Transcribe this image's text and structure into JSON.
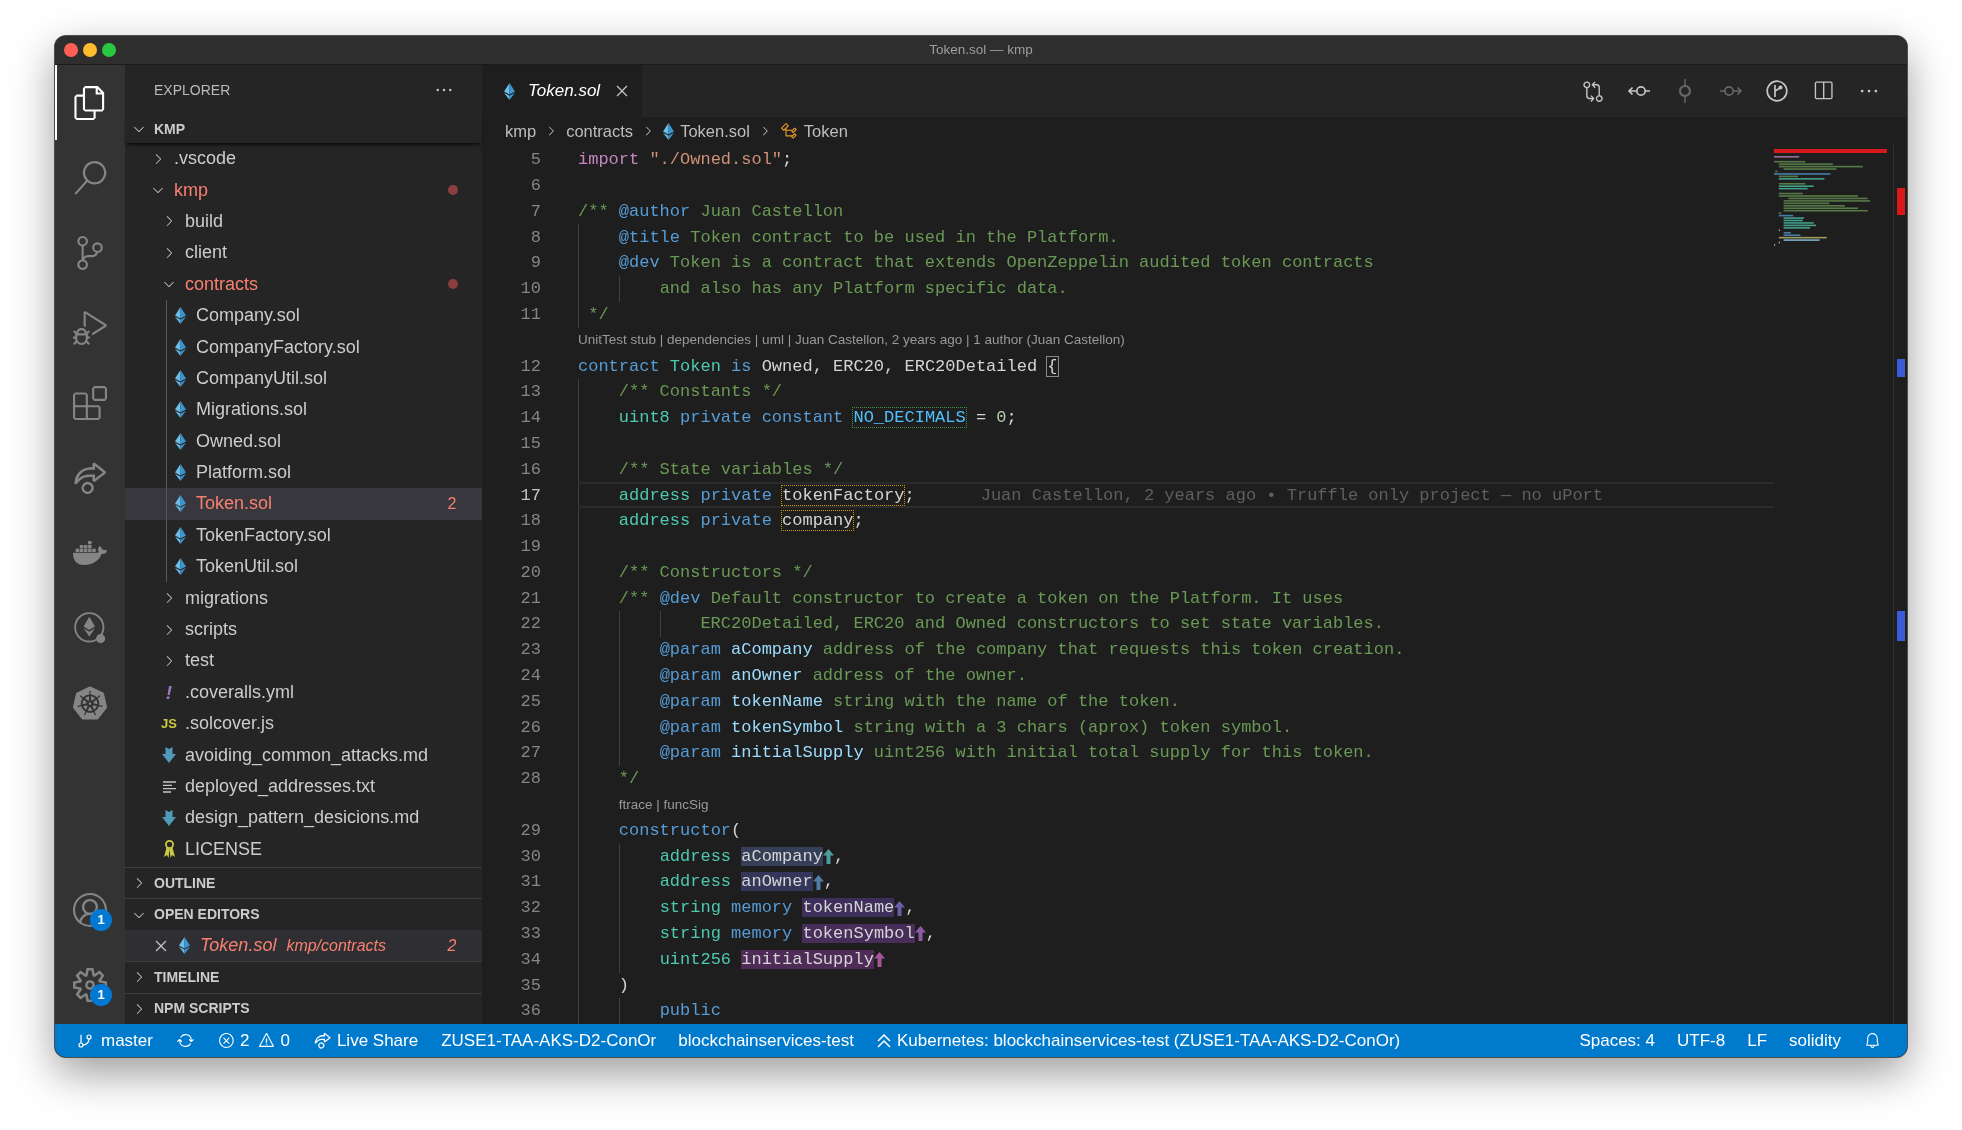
{
  "window": {
    "title": "Token.sol — kmp"
  },
  "activity_bar": {
    "items": [
      {
        "kind": "explorer",
        "selected": true
      },
      {
        "kind": "search",
        "selected": false
      },
      {
        "kind": "source_control",
        "selected": false
      },
      {
        "kind": "run_debug",
        "selected": false
      },
      {
        "kind": "extensions",
        "selected": false
      },
      {
        "kind": "live_share",
        "selected": false
      },
      {
        "kind": "docker",
        "selected": false
      },
      {
        "kind": "ethereum",
        "selected": false
      },
      {
        "kind": "kubernetes",
        "selected": false
      }
    ],
    "bottom": [
      {
        "kind": "accounts",
        "badge": "1"
      },
      {
        "kind": "manage",
        "badge": "1"
      }
    ]
  },
  "explorer": {
    "title": "EXPLORER",
    "root": {
      "label": "KMP",
      "expanded": true,
      "children": [
        {
          "name": ".vscode",
          "kind": "folder",
          "expanded": false,
          "has_errors": false,
          "selected": false
        },
        {
          "name": "kmp",
          "kind": "folder",
          "expanded": true,
          "has_errors": true,
          "selected": false,
          "children": [
            {
              "name": "build",
              "kind": "folder",
              "expanded": false,
              "has_errors": false,
              "selected": false
            },
            {
              "name": "client",
              "kind": "folder",
              "expanded": false,
              "has_errors": false,
              "selected": false
            },
            {
              "name": "contracts",
              "kind": "folder",
              "expanded": true,
              "has_errors": true,
              "selected": false,
              "children": [
                {
                  "name": "Company.sol",
                  "kind": "solidity",
                  "has_errors": false,
                  "selected": false
                },
                {
                  "name": "CompanyFactory.sol",
                  "kind": "solidity",
                  "has_errors": false,
                  "selected": false
                },
                {
                  "name": "CompanyUtil.sol",
                  "kind": "solidity",
                  "has_errors": false,
                  "selected": false
                },
                {
                  "name": "Migrations.sol",
                  "kind": "solidity",
                  "has_errors": false,
                  "selected": false
                },
                {
                  "name": "Owned.sol",
                  "kind": "solidity",
                  "has_errors": false,
                  "selected": false
                },
                {
                  "name": "Platform.sol",
                  "kind": "solidity",
                  "has_errors": false,
                  "selected": false
                },
                {
                  "name": "Token.sol",
                  "kind": "solidity",
                  "has_errors": true,
                  "selected": true,
                  "badge": "2"
                },
                {
                  "name": "TokenFactory.sol",
                  "kind": "solidity",
                  "has_errors": false,
                  "selected": false
                },
                {
                  "name": "TokenUtil.sol",
                  "kind": "solidity",
                  "has_errors": false,
                  "selected": false
                }
              ]
            },
            {
              "name": "migrations",
              "kind": "folder",
              "expanded": false,
              "has_errors": false,
              "selected": false
            },
            {
              "name": "scripts",
              "kind": "folder",
              "expanded": false,
              "has_errors": false,
              "selected": false
            },
            {
              "name": "test",
              "kind": "folder",
              "expanded": false,
              "has_errors": false,
              "selected": false
            },
            {
              "name": ".coveralls.yml",
              "kind": "yaml",
              "icon_text": "!",
              "has_errors": false,
              "selected": false
            },
            {
              "name": ".solcover.js",
              "kind": "javascript",
              "icon_text": "JS",
              "has_errors": false,
              "selected": false
            },
            {
              "name": "avoiding_common_attacks.md",
              "kind": "markdown",
              "has_errors": false,
              "selected": false
            },
            {
              "name": "deployed_addresses.txt",
              "kind": "text",
              "has_errors": false,
              "selected": false
            },
            {
              "name": "design_pattern_desicions.md",
              "kind": "markdown",
              "has_errors": false,
              "selected": false
            },
            {
              "name": "LICENSE",
              "kind": "license",
              "has_errors": false,
              "selected": false
            }
          ]
        }
      ]
    },
    "sections": [
      {
        "label": "OUTLINE",
        "expanded": false
      },
      {
        "label": "OPEN EDITORS",
        "expanded": true,
        "items": [
          {
            "name": "Token.sol",
            "path": "kmp/contracts",
            "kind": "solidity",
            "badge": "2",
            "has_errors": true,
            "preview": true,
            "selected": true
          }
        ]
      },
      {
        "label": "TIMELINE",
        "expanded": false
      },
      {
        "label": "NPM SCRIPTS",
        "expanded": false
      }
    ]
  },
  "editor": {
    "tabs": [
      {
        "label": "Token.sol",
        "kind": "solidity",
        "selected": true,
        "preview": true
      }
    ],
    "actions": [
      {
        "kind": "compare",
        "disabled": false
      },
      {
        "kind": "previous",
        "disabled": false
      },
      {
        "kind": "commit",
        "disabled": true
      },
      {
        "kind": "next",
        "disabled": true
      },
      {
        "kind": "blame",
        "disabled": false
      },
      {
        "kind": "split",
        "disabled": false
      },
      {
        "kind": "more",
        "disabled": false
      }
    ],
    "breadcrumbs": [
      {
        "label": "kmp",
        "kind": "folder"
      },
      {
        "label": "contracts",
        "kind": "folder"
      },
      {
        "label": "Token.sol",
        "kind": "solidity"
      },
      {
        "label": "Token",
        "kind": "class"
      }
    ],
    "lines": [
      {
        "kind": "code",
        "number": "5",
        "active": false,
        "segments": [
          {
            "kind": "keyword",
            "text": "import "
          },
          {
            "kind": "string",
            "text": "\"./Owned.sol\""
          },
          {
            "kind": "plain",
            "text": ";"
          }
        ]
      },
      {
        "kind": "code",
        "number": "6",
        "active": false
      },
      {
        "kind": "code",
        "number": "7",
        "active": false,
        "segments": [
          {
            "kind": "comment",
            "text": "/** "
          },
          {
            "kind": "doc_tag",
            "text": "@author"
          },
          {
            "kind": "comment",
            "text": " Juan Castellon"
          }
        ]
      },
      {
        "kind": "code",
        "number": "8",
        "active": false,
        "segments": [
          {
            "kind": "doc_tag",
            "text": "    @title"
          },
          {
            "kind": "comment",
            "text": " Token contract to be used in the Platform."
          }
        ]
      },
      {
        "kind": "code",
        "number": "9",
        "active": false,
        "segments": [
          {
            "kind": "doc_tag",
            "text": "    @dev"
          },
          {
            "kind": "comment",
            "text": " Token is a contract that extends OpenZeppelin audited token contracts"
          }
        ]
      },
      {
        "kind": "code",
        "number": "10",
        "active": false,
        "segments": [
          {
            "kind": "comment",
            "text": "        and also has any Platform specific data."
          }
        ]
      },
      {
        "kind": "code",
        "number": "11",
        "active": false,
        "segments": [
          {
            "kind": "comment",
            "text": " */"
          }
        ]
      },
      {
        "kind": "codelens",
        "text": "UnitTest stub | dependencies | uml | Juan Castellon, 2 years ago | 1 author (Juan Castellon)"
      },
      {
        "kind": "code",
        "number": "12",
        "active": false,
        "segments": [
          {
            "kind": "storage",
            "text": "contract "
          },
          {
            "kind": "type",
            "text": "Token "
          },
          {
            "kind": "storage",
            "text": "is "
          },
          {
            "kind": "plain",
            "text": "Owned, ERC20, ERC20Detailed "
          },
          {
            "kind": "bracket_match",
            "text": "{"
          }
        ]
      },
      {
        "kind": "code",
        "number": "13",
        "active": false,
        "segments": [
          {
            "kind": "comment",
            "text": "    /** Constants */"
          }
        ]
      },
      {
        "kind": "code",
        "number": "14",
        "active": false,
        "segments": [
          {
            "kind": "type",
            "text": "    uint8 "
          },
          {
            "kind": "storage",
            "text": "private constant "
          },
          {
            "kind": "constant",
            "text": "NO_DECIMALS"
          },
          {
            "kind": "plain",
            "text": " = "
          },
          {
            "kind": "number",
            "text": "0"
          },
          {
            "kind": "plain",
            "text": ";"
          }
        ]
      },
      {
        "kind": "code",
        "number": "15",
        "active": false
      },
      {
        "kind": "code",
        "number": "16",
        "active": false,
        "segments": [
          {
            "kind": "comment",
            "text": "    /** State variables */"
          }
        ]
      },
      {
        "kind": "code",
        "number": "17",
        "active": true,
        "blame": "Juan Castellon, 2 years ago • Truffle only project — no uPort",
        "segments": [
          {
            "kind": "type",
            "text": "    address "
          },
          {
            "kind": "storage",
            "text": "private "
          },
          {
            "kind": "state_variable",
            "text": "tokenFactory"
          },
          {
            "kind": "plain",
            "text": ";"
          }
        ]
      },
      {
        "kind": "code",
        "number": "18",
        "active": false,
        "segments": [
          {
            "kind": "type",
            "text": "    address "
          },
          {
            "kind": "storage",
            "text": "private "
          },
          {
            "kind": "state_variable",
            "text": "company"
          },
          {
            "kind": "plain",
            "text": ";"
          }
        ]
      },
      {
        "kind": "code",
        "number": "19",
        "active": false
      },
      {
        "kind": "code",
        "number": "20",
        "active": false,
        "segments": [
          {
            "kind": "comment",
            "text": "    /** Constructors */"
          }
        ]
      },
      {
        "kind": "code",
        "number": "21",
        "active": false,
        "segments": [
          {
            "kind": "comment",
            "text": "    /** "
          },
          {
            "kind": "doc_tag",
            "text": "@dev"
          },
          {
            "kind": "comment",
            "text": " Default constructor to create a token on the Platform. It uses"
          }
        ]
      },
      {
        "kind": "code",
        "number": "22",
        "active": false,
        "segments": [
          {
            "kind": "comment",
            "text": "            ERC20Detailed, ERC20 and Owned constructors to set state variables."
          }
        ]
      },
      {
        "kind": "code",
        "number": "23",
        "active": false,
        "segments": [
          {
            "kind": "doc_tag",
            "text": "        @param "
          },
          {
            "kind": "doc_param",
            "text": "aCompany"
          },
          {
            "kind": "comment",
            "text": " address of the company that requests this token creation."
          }
        ]
      },
      {
        "kind": "code",
        "number": "24",
        "active": false,
        "segments": [
          {
            "kind": "doc_tag",
            "text": "        @param "
          },
          {
            "kind": "doc_param",
            "text": "anOwner"
          },
          {
            "kind": "comment",
            "text": " address of the owner."
          }
        ]
      },
      {
        "kind": "code",
        "number": "25",
        "active": false,
        "segments": [
          {
            "kind": "doc_tag",
            "text": "        @param "
          },
          {
            "kind": "doc_param",
            "text": "tokenName"
          },
          {
            "kind": "comment",
            "text": " string with the name of the token."
          }
        ]
      },
      {
        "kind": "code",
        "number": "26",
        "active": false,
        "segments": [
          {
            "kind": "doc_tag",
            "text": "        @param "
          },
          {
            "kind": "doc_param",
            "text": "tokenSymbol"
          },
          {
            "kind": "comment",
            "text": " string with a 3 chars (aprox) token symbol."
          }
        ]
      },
      {
        "kind": "code",
        "number": "27",
        "active": false,
        "segments": [
          {
            "kind": "doc_tag",
            "text": "        @param "
          },
          {
            "kind": "doc_param",
            "text": "initialSupply"
          },
          {
            "kind": "comment",
            "text": " uint256 with initial total supply for this token."
          }
        ]
      },
      {
        "kind": "code",
        "number": "28",
        "active": false,
        "segments": [
          {
            "kind": "comment",
            "text": "    */"
          }
        ]
      },
      {
        "kind": "codelens",
        "text": "ftrace | funcSig"
      },
      {
        "kind": "code",
        "number": "29",
        "active": false,
        "segments": [
          {
            "kind": "storage",
            "text": "    constructor"
          },
          {
            "kind": "plain",
            "text": "("
          }
        ]
      },
      {
        "kind": "code",
        "number": "30",
        "active": false,
        "segments": [
          {
            "kind": "type",
            "text": "        address "
          },
          {
            "kind": "argument",
            "text": "aCompany",
            "color": "#4e9a9e"
          },
          {
            "kind": "plain",
            "text": ","
          }
        ]
      },
      {
        "kind": "code",
        "number": "31",
        "active": false,
        "segments": [
          {
            "kind": "type",
            "text": "        address "
          },
          {
            "kind": "argument",
            "text": "anOwner",
            "color": "#4f7ba6"
          },
          {
            "kind": "plain",
            "text": ","
          }
        ]
      },
      {
        "kind": "code",
        "number": "32",
        "active": false,
        "segments": [
          {
            "kind": "type",
            "text": "        string "
          },
          {
            "kind": "storage",
            "text": "memory "
          },
          {
            "kind": "argument",
            "text": "tokenName",
            "color": "#6b5ea8"
          },
          {
            "kind": "plain",
            "text": ","
          }
        ]
      },
      {
        "kind": "code",
        "number": "33",
        "active": false,
        "segments": [
          {
            "kind": "type",
            "text": "        string "
          },
          {
            "kind": "storage",
            "text": "memory "
          },
          {
            "kind": "argument",
            "text": "tokenSymbol",
            "color": "#8e5aa3"
          },
          {
            "kind": "plain",
            "text": ","
          }
        ]
      },
      {
        "kind": "code",
        "number": "34",
        "active": false,
        "segments": [
          {
            "kind": "type",
            "text": "        uint256 "
          },
          {
            "kind": "argument",
            "text": "initialSupply",
            "color": "#a5559a"
          }
        ]
      },
      {
        "kind": "code",
        "number": "35",
        "active": false,
        "segments": [
          {
            "kind": "plain",
            "text": "    )"
          }
        ]
      },
      {
        "kind": "code",
        "number": "36",
        "active": false,
        "segments": [
          {
            "kind": "storage",
            "text": "        public"
          }
        ]
      }
    ]
  },
  "status_bar": {
    "left": [
      {
        "kind": "branch",
        "text": "master"
      },
      {
        "kind": "sync"
      },
      {
        "kind": "problems",
        "errors": "2",
        "warnings": "0"
      },
      {
        "kind": "live_share",
        "text": "Live Share"
      },
      {
        "kind": "text",
        "text": "ZUSE1-TAA-AKS-D2-ConOr"
      },
      {
        "kind": "text",
        "text": "blockchainservices-test"
      },
      {
        "kind": "kubernetes",
        "text": "Kubernetes: blockchainservices-test (ZUSE1-TAA-AKS-D2-ConOr)"
      }
    ],
    "right": [
      {
        "kind": "text",
        "text": "Spaces: 4"
      },
      {
        "kind": "text",
        "text": "UTF-8"
      },
      {
        "kind": "text",
        "text": "LF"
      },
      {
        "kind": "text",
        "text": "solidity"
      },
      {
        "kind": "notifications"
      }
    ]
  }
}
